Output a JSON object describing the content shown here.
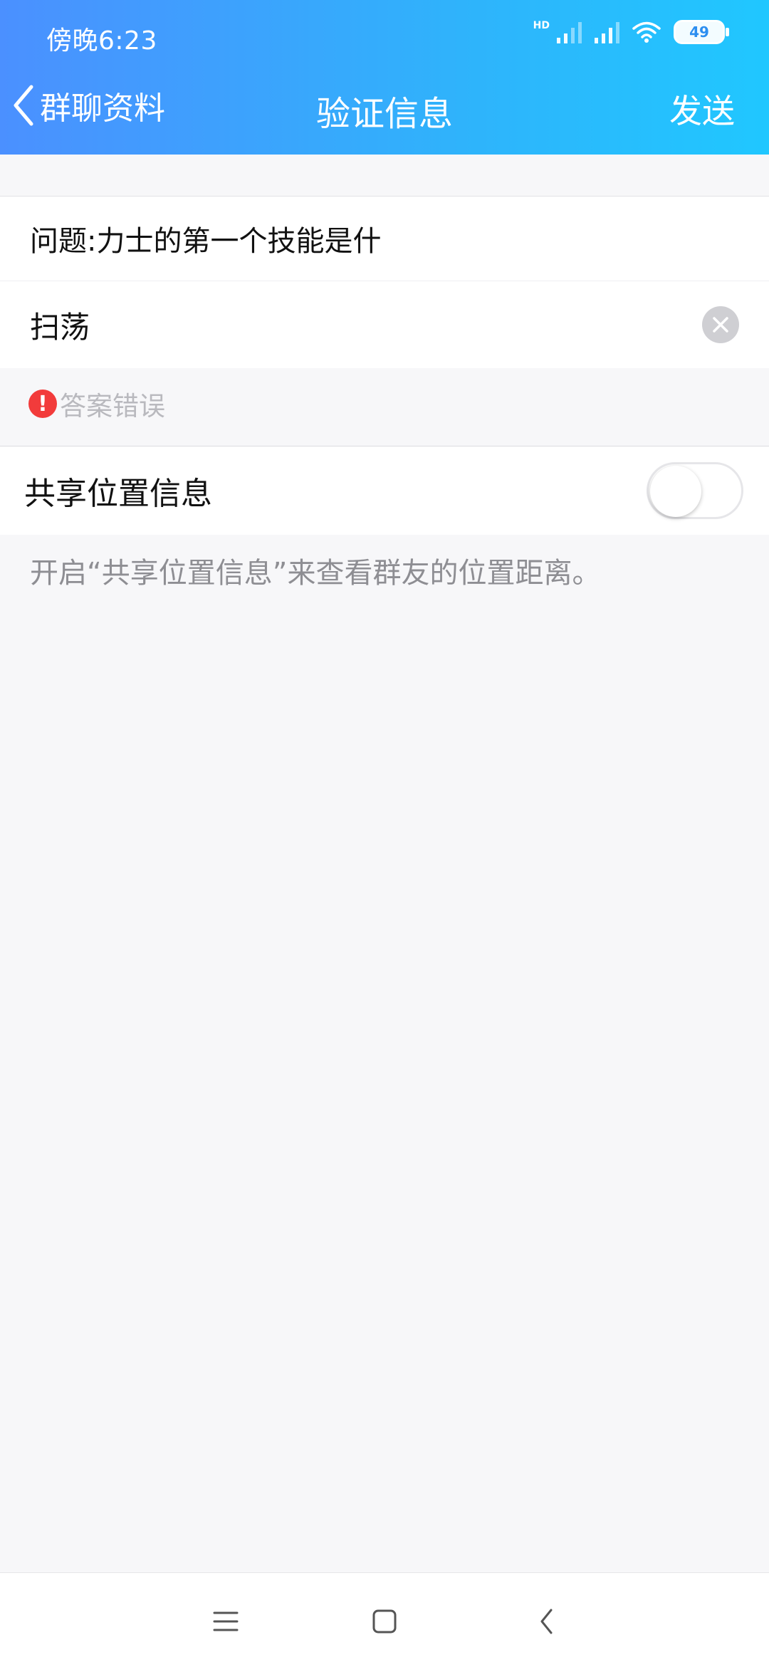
{
  "status_bar": {
    "time": "傍晚6:23",
    "hd_label": "HD",
    "battery_level": "49"
  },
  "title_bar": {
    "back_label": "群聊资料",
    "title": "验证信息",
    "send_label": "发送"
  },
  "question": {
    "text": "问题:力士的第一个技能是什"
  },
  "answer": {
    "value": "扫荡"
  },
  "error": {
    "icon": "!",
    "text": "答案错误"
  },
  "share_location": {
    "label": "共享位置信息",
    "enabled": false,
    "hint": "开启“共享位置信息”来查看群友的位置距离。"
  },
  "colors": {
    "header_gradient_start": "#4b90ff",
    "header_gradient_end": "#20c7ff",
    "error_red": "#f23b3b"
  }
}
